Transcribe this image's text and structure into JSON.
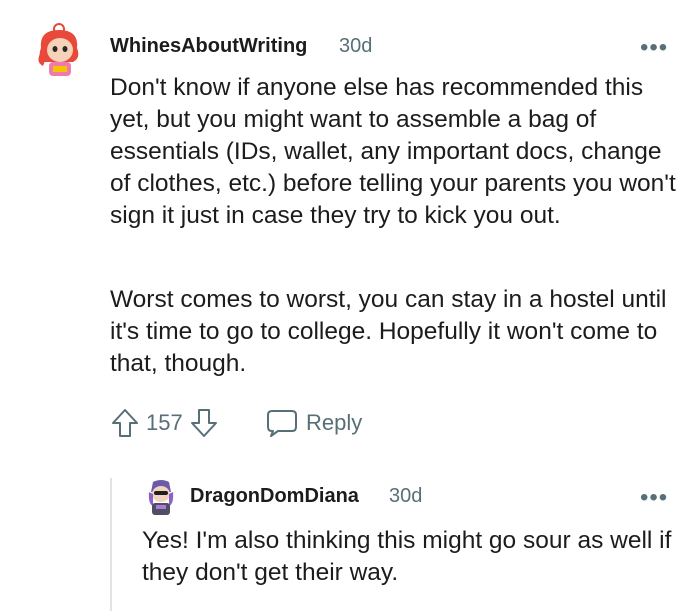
{
  "comment": {
    "username": "WhinesAboutWriting",
    "time": "30d",
    "paragraphs": [
      "Don't know if anyone else has recommended this yet, but you might want to assemble a bag of essentials (IDs, wallet, any important docs, change of clothes, etc.) before telling your parents you won't sign it just in case they try to kick you out.",
      "Worst comes to worst, you can stay in a hostel until it's time to go to college. Hopefully it won't come to that, though."
    ],
    "score": "157",
    "reply_label": "Reply",
    "more_label": "•••"
  },
  "reply": {
    "username": "DragonDomDiana",
    "time": "30d",
    "text": "Yes! I'm also thinking this might go sour as well if they don't get their way.",
    "more_label": "•••"
  },
  "colors": {
    "text": "#1c1c1c",
    "meta": "#576f76",
    "thread_line": "#e1e4e6"
  },
  "icons": [
    "upvote-icon",
    "downvote-icon",
    "comment-bubble-icon",
    "more-options-icon"
  ]
}
